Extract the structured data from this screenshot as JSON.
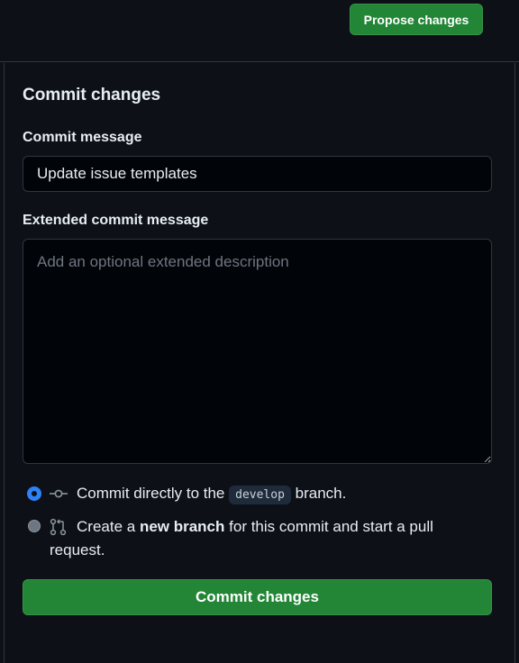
{
  "header": {
    "propose_label": "Propose changes"
  },
  "commit_form": {
    "title": "Commit changes",
    "message_label": "Commit message",
    "message_value": "Update issue templates",
    "extended_label": "Extended commit message",
    "extended_placeholder": "Add an optional extended description",
    "options": [
      {
        "selected": true,
        "icon": "git-commit-icon",
        "text_before": "Commit directly to the",
        "branch": "develop",
        "text_after": "branch."
      },
      {
        "selected": false,
        "icon": "git-pull-request-icon",
        "text_before": "Create a",
        "bold": "new branch",
        "text_after": "for this commit and start a pull",
        "text_line2": "request."
      }
    ],
    "submit_label": "Commit changes"
  },
  "colors": {
    "background": "#0d1117",
    "button_green": "#238636",
    "radio_blue": "#2f81f7",
    "border": "#30363d"
  }
}
